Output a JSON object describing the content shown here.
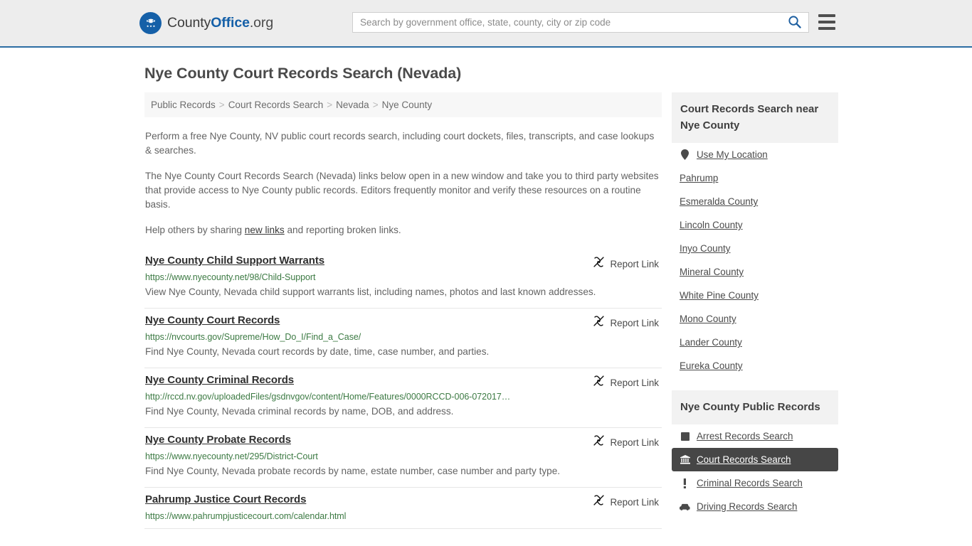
{
  "header": {
    "logo": {
      "icon": "eagle-seal-icon",
      "text_pre": "County",
      "text_bold": "Office",
      "text_post": ".org"
    },
    "search": {
      "placeholder": "Search by government office, state, county, city or zip code",
      "value": "",
      "search_icon": "search-icon"
    },
    "menu_icon": "hamburger-menu-icon"
  },
  "page": {
    "title": "Nye County Court Records Search (Nevada)"
  },
  "breadcrumb": {
    "separator": ">",
    "items": [
      {
        "label": "Public Records",
        "current": false
      },
      {
        "label": "Court Records Search",
        "current": false
      },
      {
        "label": "Nevada",
        "current": false
      },
      {
        "label": "Nye County",
        "current": true
      }
    ]
  },
  "intro": {
    "paragraph1": "Perform a free Nye County, NV public court records search, including court dockets, files, transcripts, and case lookups & searches.",
    "paragraph2": "The Nye County Court Records Search (Nevada) links below open in a new window and take you to third party websites that provide access to Nye County public records. Editors frequently monitor and verify these resources on a routine basis.",
    "paragraph3_pre": "Help others by sharing ",
    "paragraph3_link": "new links",
    "paragraph3_post": " and reporting broken links."
  },
  "results": {
    "report_label": "Report Link",
    "report_icon": "broken-link-icon",
    "items": [
      {
        "title": "Nye County Child Support Warrants",
        "url": "https://www.nyecounty.net/98/Child-Support",
        "description": "View Nye County, Nevada child support warrants list, including names, photos and last known addresses."
      },
      {
        "title": "Nye County Court Records",
        "url": "https://nvcourts.gov/Supreme/How_Do_I/Find_a_Case/",
        "description": "Find Nye County, Nevada court records by date, time, case number, and parties."
      },
      {
        "title": "Nye County Criminal Records",
        "url": "http://rccd.nv.gov/uploadedFiles/gsdnvgov/content/Home/Features/0000RCCD-006-072017…",
        "description": "Find Nye County, Nevada criminal records by name, DOB, and address."
      },
      {
        "title": "Nye County Probate Records",
        "url": "https://www.nyecounty.net/295/District-Court",
        "description": "Find Nye County, Nevada probate records by name, estate number, case number and party type."
      },
      {
        "title": "Pahrump Justice Court Records",
        "url": "https://www.pahrumpjusticecourt.com/calendar.html",
        "description": ""
      }
    ]
  },
  "sidebar": {
    "nearby": {
      "heading": "Court Records Search near Nye County",
      "items": [
        {
          "label": "Use My Location",
          "icon": "map-pin-icon",
          "active": false
        },
        {
          "label": "Pahrump",
          "icon": "",
          "active": false
        },
        {
          "label": "Esmeralda County",
          "icon": "",
          "active": false
        },
        {
          "label": "Lincoln County",
          "icon": "",
          "active": false
        },
        {
          "label": "Inyo County",
          "icon": "",
          "active": false
        },
        {
          "label": "Mineral County",
          "icon": "",
          "active": false
        },
        {
          "label": "White Pine County",
          "icon": "",
          "active": false
        },
        {
          "label": "Mono County",
          "icon": "",
          "active": false
        },
        {
          "label": "Lander County",
          "icon": "",
          "active": false
        },
        {
          "label": "Eureka County",
          "icon": "",
          "active": false
        }
      ]
    },
    "public_records": {
      "heading": "Nye County Public Records",
      "items": [
        {
          "label": "Arrest Records Search",
          "icon": "fingerprint-card-icon",
          "active": false
        },
        {
          "label": "Court Records Search",
          "icon": "courthouse-icon",
          "active": true
        },
        {
          "label": "Criminal Records Search",
          "icon": "exclamation-icon",
          "active": false
        },
        {
          "label": "Driving Records Search",
          "icon": "car-icon",
          "active": false
        }
      ]
    }
  },
  "colors": {
    "brand_blue": "#1560a8",
    "header_bg": "#ededed",
    "header_border": "#2c6da3",
    "url_green": "#3c7a43",
    "active_bg": "#464646",
    "panel_bg": "#f2f2f2"
  }
}
